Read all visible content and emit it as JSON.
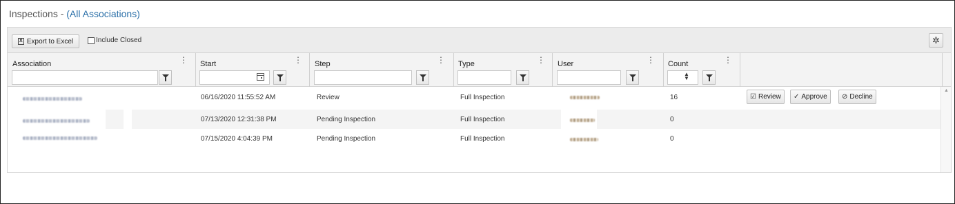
{
  "page": {
    "title_prefix": "Inspections - ",
    "title_filter": "(All Associations)"
  },
  "toolbar": {
    "export_label": "Export to Excel",
    "export_icon": "excel-icon",
    "include_closed_label": "Include Closed",
    "include_closed_checked": false,
    "settings_icon": "gear-icon"
  },
  "columns": [
    {
      "key": "association",
      "label": "Association"
    },
    {
      "key": "start",
      "label": "Start"
    },
    {
      "key": "step",
      "label": "Step"
    },
    {
      "key": "type",
      "label": "Type"
    },
    {
      "key": "user",
      "label": "User"
    },
    {
      "key": "count",
      "label": "Count"
    }
  ],
  "rows": [
    {
      "start": "06/16/2020 11:55:52 AM",
      "step": "Review",
      "type": "Full Inspection",
      "count": "16",
      "actions": [
        "Review",
        "Approve",
        "Decline"
      ]
    },
    {
      "start": "07/13/2020 12:31:38 PM",
      "step": "Pending Inspection",
      "type": "Full Inspection",
      "count": "0",
      "actions": []
    },
    {
      "start": "07/15/2020 4:04:39 PM",
      "step": "Pending Inspection",
      "type": "Full Inspection",
      "count": "0",
      "actions": []
    }
  ],
  "actions": {
    "review_label": "Review",
    "approve_label": "Approve",
    "decline_label": "Decline"
  },
  "icons": {
    "filter": "filter-icon",
    "calendar": "calendar-icon",
    "spinner": "spinner-icon",
    "kebab": "kebab-menu-icon"
  },
  "colors": {
    "link": "#2a6fa8",
    "toolbar_bg": "#ececec",
    "alt_row": "#f4f4f4"
  }
}
